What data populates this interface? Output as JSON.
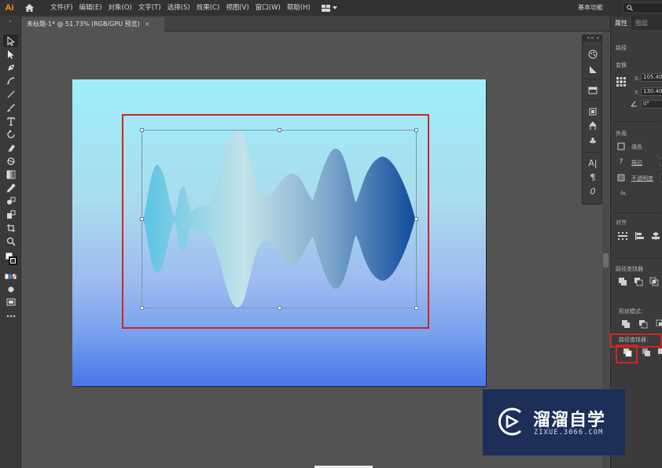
{
  "app": {
    "logo": "Ai",
    "menus": [
      "文件(F)",
      "编辑(E)",
      "对象(O)",
      "文字(T)",
      "选择(S)",
      "效果(C)",
      "视图(V)",
      "窗口(W)",
      "帮助(H)"
    ],
    "workspace": "基本功能"
  },
  "document": {
    "tab_title": "未标题-1* @ 51.73% (RGB/GPU 预览)",
    "tab_close": "×"
  },
  "wave": {
    "gradient_colors": [
      "#5bc3e3",
      "#c4e3ea",
      "#7fa8cd",
      "#0e4c9b"
    ]
  },
  "float_panel": {
    "collapse_label": "<<  ×"
  },
  "properties_panel": {
    "tabs": [
      "属性",
      "图层"
    ],
    "section_path": "路径",
    "section_transform": "变换",
    "x_label": "X:",
    "x_value": "105.40",
    "y_label": "Y:",
    "y_value": "130.40",
    "rotate_value": "0°",
    "section_appearance": "外观",
    "fill_label": "填色",
    "stroke_label": "描边",
    "opacity_label": "不透明度",
    "fx_label": "fx.",
    "section_align": "对齐",
    "section_pathfinder": "路径查找器",
    "shape_modes_label": "形状模式：",
    "pathfinder_label": "路径查找器："
  },
  "watermark": {
    "title": "溜溜自学",
    "subtitle": "ZIXUE.3066.COM"
  }
}
